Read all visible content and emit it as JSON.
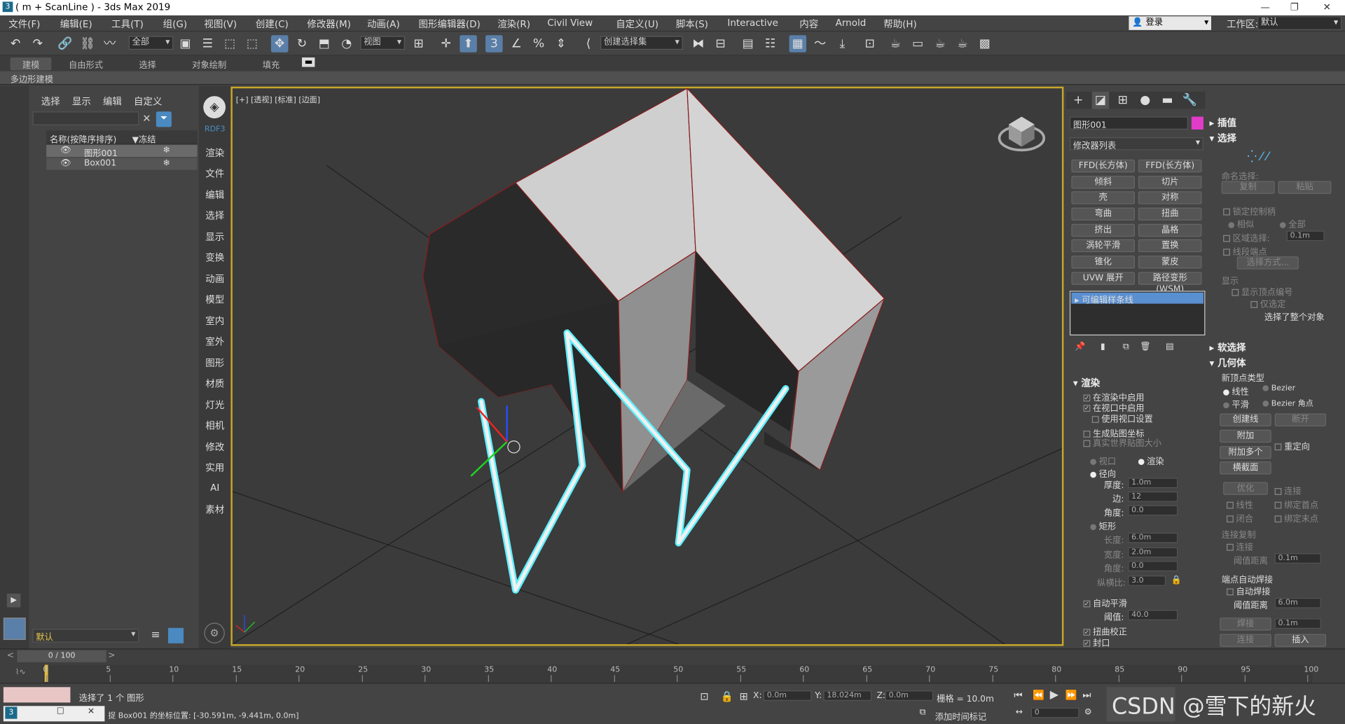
{
  "window": {
    "title": "( m + ScanLine ) - 3ds Max 2019",
    "controls": [
      "—",
      "❐",
      "✕"
    ]
  },
  "menu": [
    "文件(F)",
    "编辑(E)",
    "工具(T)",
    "组(G)",
    "视图(V)",
    "创建(C)",
    "修改器(M)",
    "动画(A)",
    "图形编辑器(D)",
    "渲染(R)",
    "Civil View",
    "自定义(U)",
    "脚本(S)",
    "Interactive",
    "内容",
    "Arnold",
    "帮助(H)"
  ],
  "account": {
    "login": "登录",
    "workspace_label": "工作区:",
    "workspace_value": "默认"
  },
  "toolbar": {
    "filter": "全部",
    "refcoord": "视图",
    "selection_set": "创建选择集"
  },
  "ribbon": {
    "tabs": [
      "建模",
      "自由形式",
      "选择",
      "对象绘制",
      "填充"
    ],
    "sub": "多边形建模"
  },
  "explorer": {
    "menu": [
      "选择",
      "显示",
      "编辑",
      "自定义"
    ],
    "col_name": "名称(按降序排序)",
    "col_freeze": "▼冻结",
    "rows": [
      "图形001",
      "Box001"
    ],
    "layer": "默认"
  },
  "categories": [
    "RDF3",
    "渲染",
    "文件",
    "编辑",
    "选择",
    "显示",
    "变换",
    "动画",
    "模型",
    "室内",
    "室外",
    "图形",
    "材质",
    "灯光",
    "相机",
    "修改",
    "实用",
    "AI",
    "素材"
  ],
  "viewport": {
    "label": "[+] [透视] [标准] [边面]"
  },
  "modify": {
    "object_name": "图形001",
    "modifier_list": "修改器列表",
    "buttons": [
      "FFD(长方体)",
      "FFD(长方体)",
      "倾斜",
      "切片",
      "壳",
      "对称",
      "弯曲",
      "扭曲",
      "挤出",
      "晶格",
      "涡轮平滑",
      "置换",
      "锥化",
      "蒙皮",
      "UVW 展开",
      "路径变形(WSM)"
    ],
    "stack_item": "可编辑样条线",
    "render_title": "渲染",
    "render_opts": [
      "在渲染中启用",
      "在视口中启用",
      "使用视口设置",
      "生成贴图坐标",
      "真实世界贴图大小"
    ],
    "viewport_radio": "视口",
    "render_radio": "渲染",
    "radial": "径向",
    "thickness_label": "厚度:",
    "thickness": "1.0m",
    "sides_label": "边:",
    "sides": "12",
    "angle_label": "角度:",
    "angle": "0.0",
    "rect": "矩形",
    "length_label": "长度:",
    "length": "6.0m",
    "width_label": "宽度:",
    "width": "2.0m",
    "angle2_label": "角度:",
    "angle2": "0.0",
    "aspect_label": "纵横比:",
    "aspect": "3.0",
    "auto_smooth": "自动平滑",
    "threshold_label": "阈值:",
    "threshold": "40.0",
    "twist_correct": "扭曲校正",
    "cap": "封口"
  },
  "rollouts": {
    "interp": "插值",
    "selection": "选择",
    "named_sel": "命名选择:",
    "copy": "复制",
    "paste": "粘贴",
    "lock_handles": "锁定控制柄",
    "alike": "相似",
    "all": "全部",
    "area_sel": "区域选择:",
    "area_val": "0.1m",
    "seg_end": "线段端点",
    "sel_by": "选择方式...",
    "display": "显示",
    "show_vert": "显示顶点编号",
    "only_sel": "仅选定",
    "whole_obj": "选择了整个对象",
    "soft_sel": "软选择",
    "geometry": "几何体",
    "new_vert_type": "新顶点类型",
    "linear": "线性",
    "bezier": "Bezier",
    "smooth": "平滑",
    "bezier_corner": "Bezier 角点",
    "create_line": "创建线",
    "break": "断开",
    "attach": "附加",
    "reorient": "重定向",
    "attach_multi": "附加多个",
    "cross_section": "横截面",
    "refine": "优化",
    "connect": "连接",
    "linear2": "线性",
    "bind_first": "绑定首点",
    "closed": "闭合",
    "bind_last": "绑定末点",
    "conn_copy": "连接复制",
    "connect2": "连接",
    "thresh_dist": "阈值距离",
    "thresh_val": "0.1m",
    "end_auto_weld": "端点自动焊接",
    "auto_weld": "自动焊接",
    "thresh_dist2": "阈值距离",
    "thresh_val2": "6.0m",
    "weld": "焊接",
    "weld_val": "0.1m",
    "connect3": "连接",
    "insert": "插入"
  },
  "timeline": {
    "frame": "0 / 100",
    "ticks": [
      "0",
      "5",
      "10",
      "15",
      "20",
      "25",
      "30",
      "35",
      "40",
      "45",
      "50",
      "55",
      "60",
      "65",
      "70",
      "75",
      "80",
      "85",
      "90",
      "95",
      "100"
    ]
  },
  "status": {
    "selected": "选择了 1 个 图形",
    "prompt": "捉 Box001 的坐标位置: [-30.591m, -9.441m, 0.0m]",
    "x_label": "X:",
    "x": "0.0m",
    "y_label": "Y:",
    "y": "18.024m",
    "z_label": "Z:",
    "z": "0.0m",
    "grid": "栅格 = 10.0m",
    "add_time_tag": "添加时间标记",
    "frame_field": "0",
    "watermark": "CSDN @雪下的新火"
  }
}
